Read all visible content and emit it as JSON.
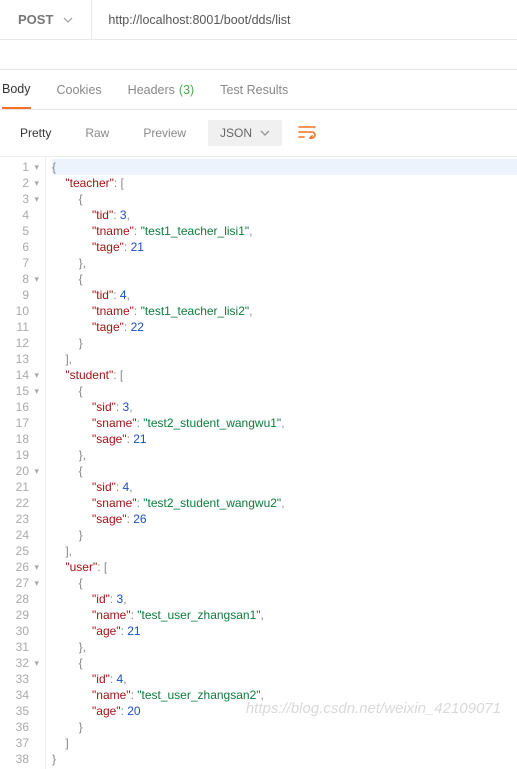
{
  "request": {
    "method": "POST",
    "url": "http://localhost:8001/boot/dds/list"
  },
  "tabs": {
    "body": "Body",
    "cookies": "Cookies",
    "headers": "Headers",
    "headers_count": "(3)",
    "tests": "Test Results"
  },
  "toolbar": {
    "pretty": "Pretty",
    "raw": "Raw",
    "preview": "Preview",
    "format": "JSON"
  },
  "code_lines": [
    {
      "n": 1,
      "f": true,
      "hl": true,
      "seg": [
        {
          "c": "p",
          "t": "{"
        }
      ]
    },
    {
      "n": 2,
      "f": true,
      "seg": [
        {
          "c": "",
          "t": "    "
        },
        {
          "c": "k",
          "t": "\"teacher\""
        },
        {
          "c": "p",
          "t": ": ["
        }
      ]
    },
    {
      "n": 3,
      "f": true,
      "seg": [
        {
          "c": "",
          "t": "        "
        },
        {
          "c": "p",
          "t": "{"
        }
      ]
    },
    {
      "n": 4,
      "seg": [
        {
          "c": "",
          "t": "            "
        },
        {
          "c": "k",
          "t": "\"tid\""
        },
        {
          "c": "p",
          "t": ": "
        },
        {
          "c": "n",
          "t": "3"
        },
        {
          "c": "p",
          "t": ","
        }
      ]
    },
    {
      "n": 5,
      "seg": [
        {
          "c": "",
          "t": "            "
        },
        {
          "c": "k",
          "t": "\"tname\""
        },
        {
          "c": "p",
          "t": ": "
        },
        {
          "c": "s",
          "t": "\"test1_teacher_lisi1\""
        },
        {
          "c": "p",
          "t": ","
        }
      ]
    },
    {
      "n": 6,
      "seg": [
        {
          "c": "",
          "t": "            "
        },
        {
          "c": "k",
          "t": "\"tage\""
        },
        {
          "c": "p",
          "t": ": "
        },
        {
          "c": "n",
          "t": "21"
        }
      ]
    },
    {
      "n": 7,
      "seg": [
        {
          "c": "",
          "t": "        "
        },
        {
          "c": "p",
          "t": "},"
        }
      ]
    },
    {
      "n": 8,
      "f": true,
      "seg": [
        {
          "c": "",
          "t": "        "
        },
        {
          "c": "p",
          "t": "{"
        }
      ]
    },
    {
      "n": 9,
      "seg": [
        {
          "c": "",
          "t": "            "
        },
        {
          "c": "k",
          "t": "\"tid\""
        },
        {
          "c": "p",
          "t": ": "
        },
        {
          "c": "n",
          "t": "4"
        },
        {
          "c": "p",
          "t": ","
        }
      ]
    },
    {
      "n": 10,
      "seg": [
        {
          "c": "",
          "t": "            "
        },
        {
          "c": "k",
          "t": "\"tname\""
        },
        {
          "c": "p",
          "t": ": "
        },
        {
          "c": "s",
          "t": "\"test1_teacher_lisi2\""
        },
        {
          "c": "p",
          "t": ","
        }
      ]
    },
    {
      "n": 11,
      "seg": [
        {
          "c": "",
          "t": "            "
        },
        {
          "c": "k",
          "t": "\"tage\""
        },
        {
          "c": "p",
          "t": ": "
        },
        {
          "c": "n",
          "t": "22"
        }
      ]
    },
    {
      "n": 12,
      "seg": [
        {
          "c": "",
          "t": "        "
        },
        {
          "c": "p",
          "t": "}"
        }
      ]
    },
    {
      "n": 13,
      "seg": [
        {
          "c": "",
          "t": "    "
        },
        {
          "c": "p",
          "t": "],"
        }
      ]
    },
    {
      "n": 14,
      "f": true,
      "seg": [
        {
          "c": "",
          "t": "    "
        },
        {
          "c": "k",
          "t": "\"student\""
        },
        {
          "c": "p",
          "t": ": ["
        }
      ]
    },
    {
      "n": 15,
      "f": true,
      "seg": [
        {
          "c": "",
          "t": "        "
        },
        {
          "c": "p",
          "t": "{"
        }
      ]
    },
    {
      "n": 16,
      "seg": [
        {
          "c": "",
          "t": "            "
        },
        {
          "c": "k",
          "t": "\"sid\""
        },
        {
          "c": "p",
          "t": ": "
        },
        {
          "c": "n",
          "t": "3"
        },
        {
          "c": "p",
          "t": ","
        }
      ]
    },
    {
      "n": 17,
      "seg": [
        {
          "c": "",
          "t": "            "
        },
        {
          "c": "k",
          "t": "\"sname\""
        },
        {
          "c": "p",
          "t": ": "
        },
        {
          "c": "s",
          "t": "\"test2_student_wangwu1\""
        },
        {
          "c": "p",
          "t": ","
        }
      ]
    },
    {
      "n": 18,
      "seg": [
        {
          "c": "",
          "t": "            "
        },
        {
          "c": "k",
          "t": "\"sage\""
        },
        {
          "c": "p",
          "t": ": "
        },
        {
          "c": "n",
          "t": "21"
        }
      ]
    },
    {
      "n": 19,
      "seg": [
        {
          "c": "",
          "t": "        "
        },
        {
          "c": "p",
          "t": "},"
        }
      ]
    },
    {
      "n": 20,
      "f": true,
      "seg": [
        {
          "c": "",
          "t": "        "
        },
        {
          "c": "p",
          "t": "{"
        }
      ]
    },
    {
      "n": 21,
      "seg": [
        {
          "c": "",
          "t": "            "
        },
        {
          "c": "k",
          "t": "\"sid\""
        },
        {
          "c": "p",
          "t": ": "
        },
        {
          "c": "n",
          "t": "4"
        },
        {
          "c": "p",
          "t": ","
        }
      ]
    },
    {
      "n": 22,
      "seg": [
        {
          "c": "",
          "t": "            "
        },
        {
          "c": "k",
          "t": "\"sname\""
        },
        {
          "c": "p",
          "t": ": "
        },
        {
          "c": "s",
          "t": "\"test2_student_wangwu2\""
        },
        {
          "c": "p",
          "t": ","
        }
      ]
    },
    {
      "n": 23,
      "seg": [
        {
          "c": "",
          "t": "            "
        },
        {
          "c": "k",
          "t": "\"sage\""
        },
        {
          "c": "p",
          "t": ": "
        },
        {
          "c": "n",
          "t": "26"
        }
      ]
    },
    {
      "n": 24,
      "seg": [
        {
          "c": "",
          "t": "        "
        },
        {
          "c": "p",
          "t": "}"
        }
      ]
    },
    {
      "n": 25,
      "seg": [
        {
          "c": "",
          "t": "    "
        },
        {
          "c": "p",
          "t": "],"
        }
      ]
    },
    {
      "n": 26,
      "f": true,
      "seg": [
        {
          "c": "",
          "t": "    "
        },
        {
          "c": "k",
          "t": "\"user\""
        },
        {
          "c": "p",
          "t": ": ["
        }
      ]
    },
    {
      "n": 27,
      "f": true,
      "seg": [
        {
          "c": "",
          "t": "        "
        },
        {
          "c": "p",
          "t": "{"
        }
      ]
    },
    {
      "n": 28,
      "seg": [
        {
          "c": "",
          "t": "            "
        },
        {
          "c": "k",
          "t": "\"id\""
        },
        {
          "c": "p",
          "t": ": "
        },
        {
          "c": "n",
          "t": "3"
        },
        {
          "c": "p",
          "t": ","
        }
      ]
    },
    {
      "n": 29,
      "seg": [
        {
          "c": "",
          "t": "            "
        },
        {
          "c": "k",
          "t": "\"name\""
        },
        {
          "c": "p",
          "t": ": "
        },
        {
          "c": "s",
          "t": "\"test_user_zhangsan1\""
        },
        {
          "c": "p",
          "t": ","
        }
      ]
    },
    {
      "n": 30,
      "seg": [
        {
          "c": "",
          "t": "            "
        },
        {
          "c": "k",
          "t": "\"age\""
        },
        {
          "c": "p",
          "t": ": "
        },
        {
          "c": "n",
          "t": "21"
        }
      ]
    },
    {
      "n": 31,
      "seg": [
        {
          "c": "",
          "t": "        "
        },
        {
          "c": "p",
          "t": "},"
        }
      ]
    },
    {
      "n": 32,
      "f": true,
      "seg": [
        {
          "c": "",
          "t": "        "
        },
        {
          "c": "p",
          "t": "{"
        }
      ]
    },
    {
      "n": 33,
      "seg": [
        {
          "c": "",
          "t": "            "
        },
        {
          "c": "k",
          "t": "\"id\""
        },
        {
          "c": "p",
          "t": ": "
        },
        {
          "c": "n",
          "t": "4"
        },
        {
          "c": "p",
          "t": ","
        }
      ]
    },
    {
      "n": 34,
      "seg": [
        {
          "c": "",
          "t": "            "
        },
        {
          "c": "k",
          "t": "\"name\""
        },
        {
          "c": "p",
          "t": ": "
        },
        {
          "c": "s",
          "t": "\"test_user_zhangsan2\""
        },
        {
          "c": "p",
          "t": ","
        }
      ]
    },
    {
      "n": 35,
      "seg": [
        {
          "c": "",
          "t": "            "
        },
        {
          "c": "k",
          "t": "\"age\""
        },
        {
          "c": "p",
          "t": ": "
        },
        {
          "c": "n",
          "t": "20"
        }
      ]
    },
    {
      "n": 36,
      "seg": [
        {
          "c": "",
          "t": "        "
        },
        {
          "c": "p",
          "t": "}"
        }
      ]
    },
    {
      "n": 37,
      "seg": [
        {
          "c": "",
          "t": "    "
        },
        {
          "c": "p",
          "t": "]"
        }
      ]
    },
    {
      "n": 38,
      "seg": [
        {
          "c": "p",
          "t": "}"
        }
      ]
    }
  ],
  "watermark": "https://blog.csdn.net/weixin_42109071"
}
